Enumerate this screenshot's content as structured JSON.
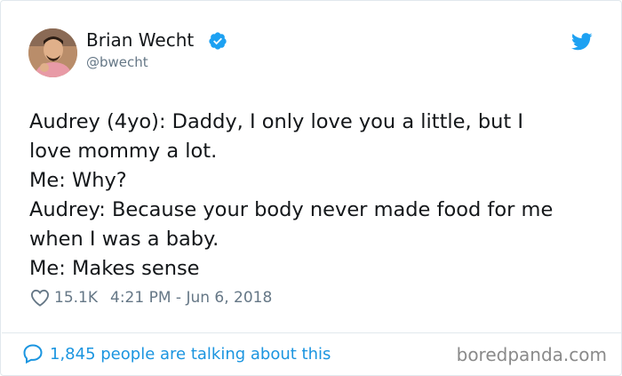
{
  "author": {
    "name": "Brian Wecht",
    "handle": "@bwecht",
    "verified": true
  },
  "tweet": {
    "lines": [
      "Audrey (4yo): Daddy, I only love you a little, but I",
      "love mommy a lot.",
      "Me: Why?",
      "Audrey: Because your body never made food for me",
      "when I was a baby.",
      "Me: Makes sense"
    ],
    "likes": "15.1K",
    "timestamp": "4:21 PM - Jun 6, 2018"
  },
  "footer": {
    "talking": "1,845 people are talking about this",
    "watermark": "boredpanda.com"
  },
  "icons": {
    "verified": "verified-badge-icon",
    "twitter": "twitter-bird-icon",
    "heart": "heart-outline-icon",
    "comment": "speech-bubble-icon"
  },
  "colors": {
    "text": "#14171a",
    "secondary": "#657786",
    "accent": "#1da1f2",
    "link": "#1b95e0",
    "border": "#e1e8ed"
  }
}
